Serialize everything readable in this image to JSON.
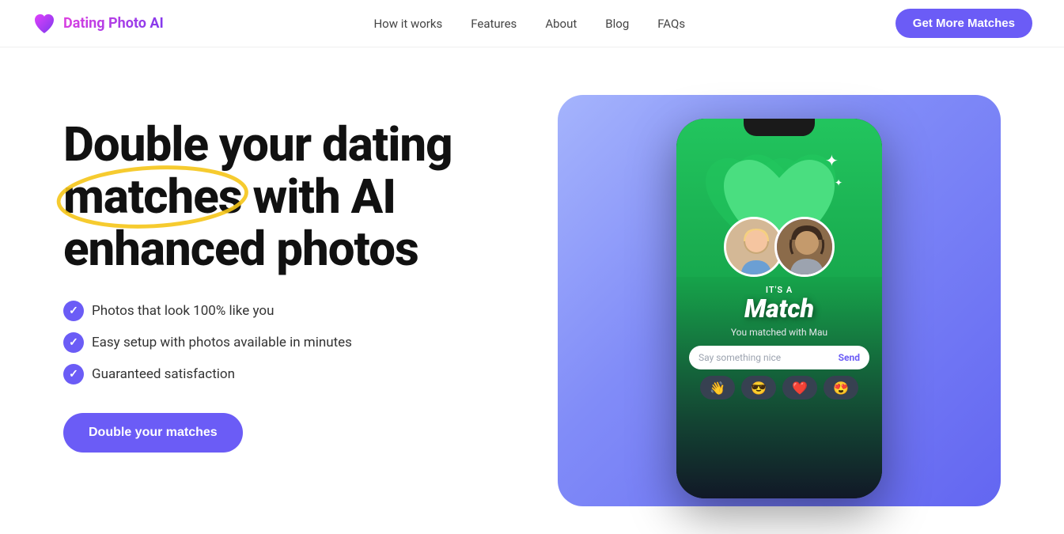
{
  "nav": {
    "logo_text": "Dating Photo AI",
    "links": [
      {
        "label": "How it works",
        "id": "how-it-works"
      },
      {
        "label": "Features",
        "id": "features"
      },
      {
        "label": "About",
        "id": "about"
      },
      {
        "label": "Blog",
        "id": "blog"
      },
      {
        "label": "FAQs",
        "id": "faqs"
      }
    ],
    "cta_label": "Get More Matches"
  },
  "hero": {
    "title_line1": "Double your dating",
    "title_line2": "matches",
    "title_line3": " with AI",
    "title_line4": "enhanced photos",
    "checklist": [
      "Photos that look 100% like you",
      "Easy setup with photos available in minutes",
      "Guaranteed satisfaction"
    ],
    "cta_label": "Double your matches"
  },
  "phone_mockup": {
    "its_a": "IT'S A",
    "match": "Match",
    "you_matched": "You matched with Mau",
    "message_placeholder": "Say something nice",
    "send_label": "Send",
    "emojis": [
      "👋",
      "😎",
      "❤️",
      "😍"
    ]
  }
}
